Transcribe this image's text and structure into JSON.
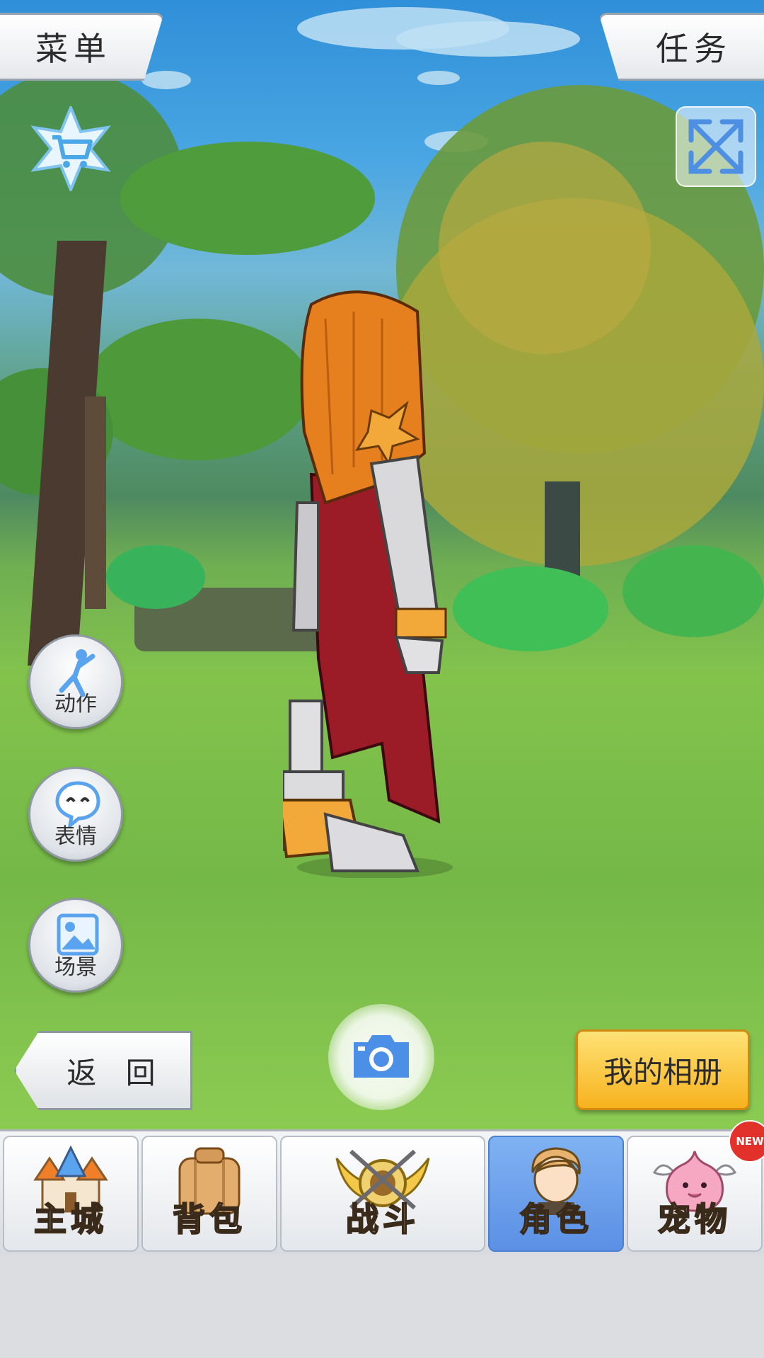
{
  "top_bar": {
    "menu_label": "菜单",
    "task_label": "任务"
  },
  "icons": {
    "shop": "shop-star-icon",
    "fullscreen": "fullscreen-icon",
    "camera": "camera-icon"
  },
  "side_buttons": [
    {
      "label": "动作",
      "icon": "pose-icon"
    },
    {
      "label": "表情",
      "icon": "emote-icon"
    },
    {
      "label": "场景",
      "icon": "scene-icon"
    }
  ],
  "bottom_actions": {
    "back_label": "返 回",
    "album_label": "我的相册"
  },
  "nav_tabs": [
    {
      "label": "主城",
      "icon": "castle-icon",
      "active": false
    },
    {
      "label": "背包",
      "icon": "backpack-icon",
      "active": false
    },
    {
      "label": "战斗",
      "icon": "battle-icon",
      "active": false
    },
    {
      "label": "角色",
      "icon": "character-icon",
      "active": true
    },
    {
      "label": "宠物",
      "icon": "pet-icon",
      "active": false
    }
  ],
  "badge": {
    "pet_new": "NEW"
  },
  "colors": {
    "accent_active_tab": "#5b90e5",
    "album_button": "#f7b21d",
    "badge": "#e2312b"
  }
}
